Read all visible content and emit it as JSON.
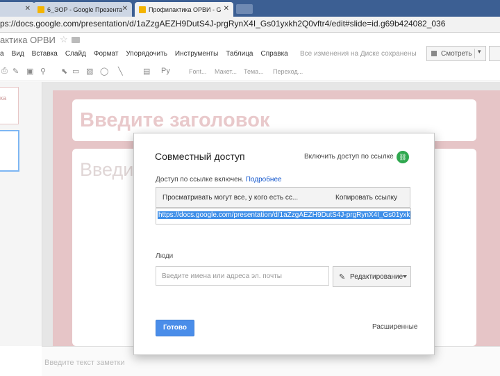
{
  "browser": {
    "tabs": [
      {
        "label": ""
      },
      {
        "label": "6_ЭОР - Google Презента"
      },
      {
        "label": "Профилактика ОРВИ - G"
      }
    ],
    "url": "ps://docs.google.com/presentation/d/1aZzgAEZH9DutS4J-prgRynX4I_Gs01yxkh2Q0vftr4/edit#slide=id.g69b424082_036"
  },
  "doc": {
    "title": "актика ОРВИ",
    "menu": [
      "а",
      "Вид",
      "Вставка",
      "Слайд",
      "Формат",
      "Упорядочить",
      "Инструменты",
      "Таблица",
      "Справка"
    ],
    "save_status": "Все изменения на Диске сохранены",
    "present_label": "Смотреть"
  },
  "toolbar": {
    "font": "Font...",
    "layout": "Макет...",
    "theme": "Тема...",
    "transition": "Переход..."
  },
  "filmstrip": {
    "thumb1_text": "ка"
  },
  "slide": {
    "title_placeholder": "Введите заголовок",
    "body_placeholder": "Введи"
  },
  "notes": {
    "placeholder": "Введите текст заметки"
  },
  "share_dialog": {
    "title": "Совместный доступ",
    "link_toggle": "Включить доступ по ссылке",
    "status_prefix": "Доступ по ссылке включен.",
    "status_more": "Подробнее",
    "access_option": "Просматривать могут все, у кого есть сс...",
    "copy_link": "Копировать ссылку",
    "share_url": "https://docs.google.com/presentation/d/1aZzgAEZH9DutS4J-prgRynX4I_Gs01yxkh",
    "people_label": "Люди",
    "people_placeholder": "Введите имена или адреса эл. почты",
    "permission": "Редактирование",
    "done_label": "Готово",
    "advanced_label": "Расширенные"
  }
}
